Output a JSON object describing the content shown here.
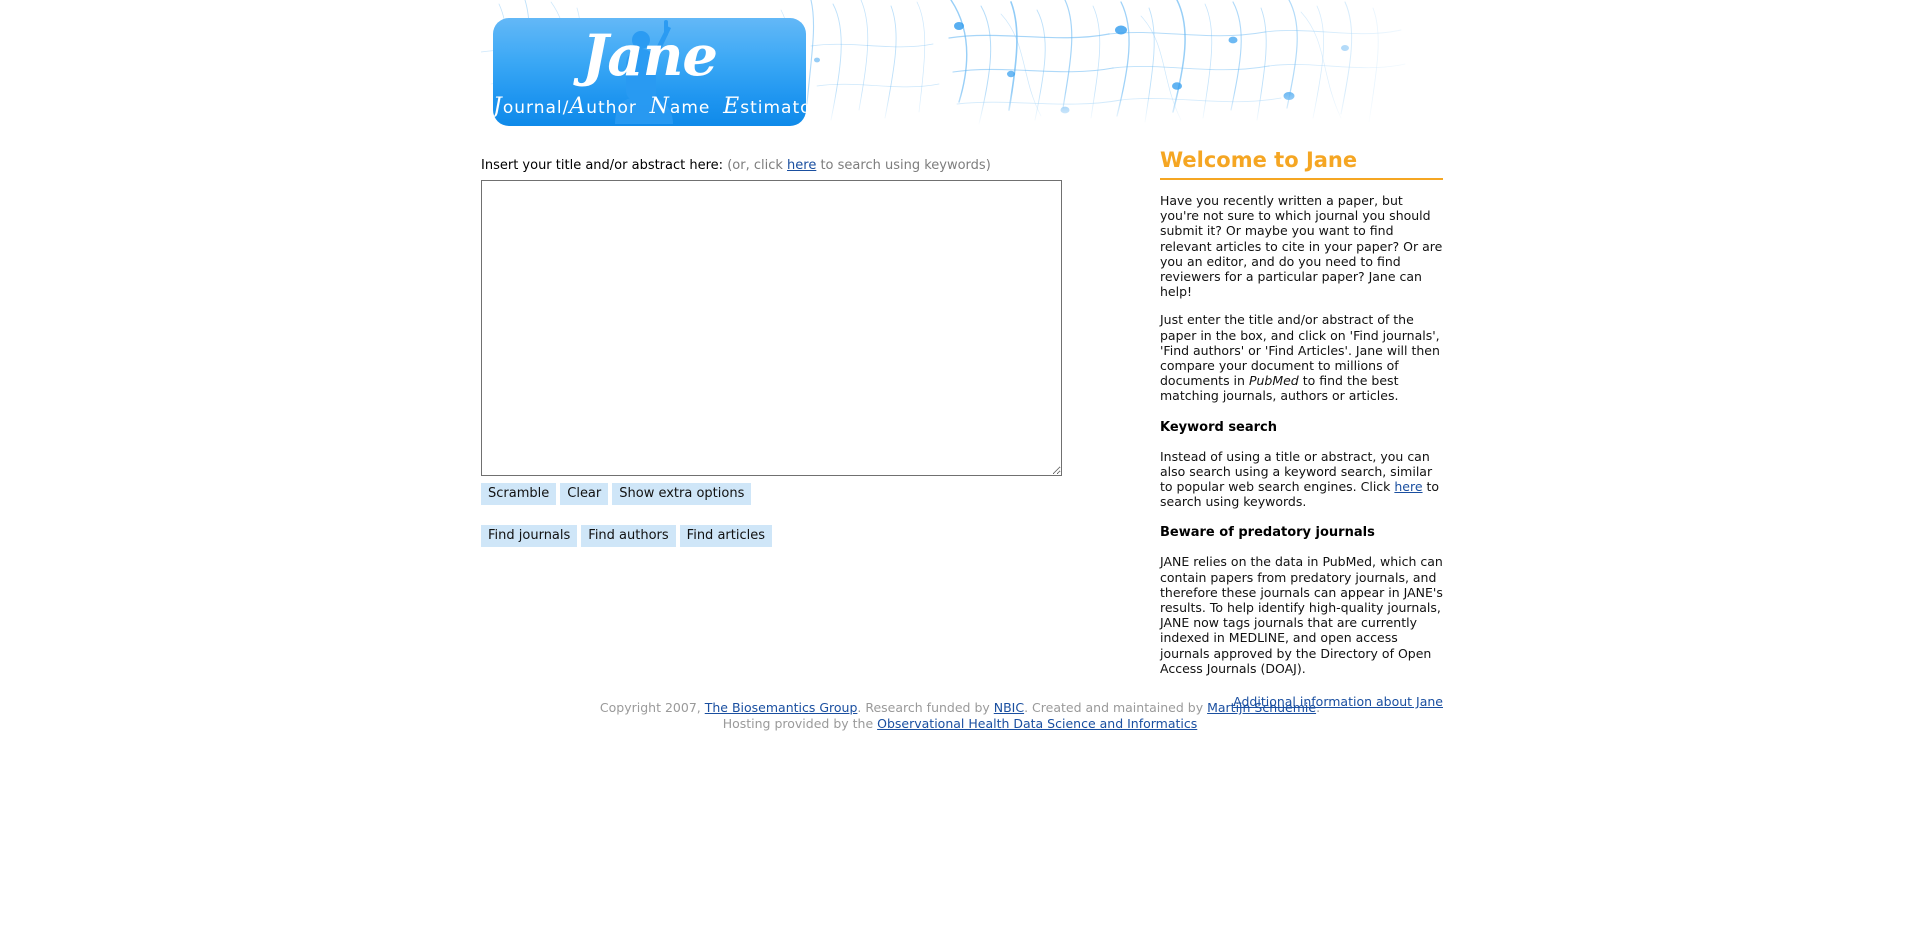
{
  "banner": {
    "logo_title": "Jane",
    "logo_subtitle_parts": [
      "J",
      "ournal/",
      "A",
      "uthor ",
      "N",
      "ame ",
      "E",
      "stimator"
    ],
    "logo_subtitle": "Journal/Author Name Estimator",
    "background_icon": "neuron-network-image",
    "person_icon": "jane-silhouette-icon",
    "accent_color": "#2196f3"
  },
  "form": {
    "label": "Insert your title and/or abstract here:",
    "hint_prefix": "(or, click ",
    "hint_link": "here",
    "hint_suffix": " to search using keywords)",
    "textarea_value": "",
    "textarea_placeholder": "",
    "buttons_row1": [
      {
        "label": "Scramble",
        "name": "scramble-button"
      },
      {
        "label": "Clear",
        "name": "clear-button"
      },
      {
        "label": "Show extra options",
        "name": "show-extra-options-button"
      }
    ],
    "buttons_row2": [
      {
        "label": "Find journals",
        "name": "find-journals-button"
      },
      {
        "label": "Find authors",
        "name": "find-authors-button"
      },
      {
        "label": "Find articles",
        "name": "find-articles-button"
      }
    ],
    "button_color": "#cfe6f8",
    "resize_handle_icon": "resize-grip-icon"
  },
  "welcome": {
    "title": "Welcome to Jane",
    "title_color": "#f5a623",
    "paragraph1": "Have you recently written a paper, but you're not sure to which journal you should submit it? Or maybe you want to find relevant articles to cite in your paper? Or are you an editor, and do you need to find reviewers for a particular paper? Jane can help!",
    "paragraph2_part1": "Just enter the title and/or abstract of the paper in the box, and click on 'Find journals', 'Find authors' or 'Find Articles'. Jane will then compare your document to millions of documents in ",
    "paragraph2_italic": "PubMed",
    "paragraph2_part2": " to find the best matching journals, authors or articles.",
    "keyword_heading": "Keyword search",
    "keyword_part1": "Instead of using a title or abstract, you can also search using a keyword search, similar to popular web search engines. Click ",
    "keyword_link": "here",
    "keyword_part2": " to search using keywords.",
    "predatory_heading": "Beware of predatory journals",
    "predatory_paragraph": "JANE relies on the data in PubMed, which can contain papers from predatory journals, and therefore these journals can appear in JANE's results. To help identify high-quality journals, JANE now tags journals that are currently indexed in MEDLINE, and open access journals approved by the Directory of Open Access Journals (DOAJ).",
    "additional_info_link": "Additional information about Jane"
  },
  "footer": {
    "line1_part1": "Copyright 2007, ",
    "line1_link1": "The Biosemantics Group",
    "line1_part2": ". Research funded by ",
    "line1_link2": "NBIC",
    "line1_part3": ". Created and maintained by ",
    "line1_link3": "Martijn Schuemie",
    "line1_part4": ".",
    "line2_part1": "Hosting provided by the ",
    "line2_link1": "Observational Health Data Science and Informatics"
  }
}
